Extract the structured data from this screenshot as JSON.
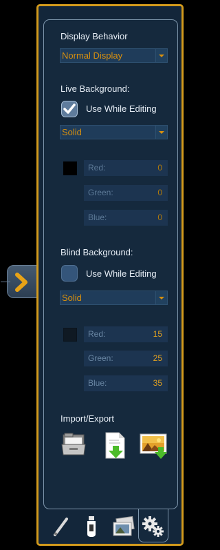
{
  "display_behavior": {
    "label": "Display Behavior",
    "value": "Normal Display"
  },
  "live_background": {
    "label": "Live Background:",
    "use_while_editing_label": "Use While Editing",
    "use_while_editing_checked": true,
    "mode": "Solid",
    "color": "#000000",
    "red_label": "Red:",
    "red": "0",
    "green_label": "Green:",
    "green": "0",
    "blue_label": "Blue:",
    "blue": "0"
  },
  "blind_background": {
    "label": "Blind Background:",
    "use_while_editing_label": "Use While Editing",
    "use_while_editing_checked": false,
    "mode": "Solid",
    "color": "#0f1923",
    "red_label": "Red:",
    "red": "15",
    "green_label": "Green:",
    "green": "25",
    "blue_label": "Blue:",
    "blue": "35"
  },
  "import_export": {
    "label": "Import/Export",
    "icons": [
      "folder-open-icon",
      "document-import-icon",
      "image-import-icon"
    ]
  },
  "tabs": [
    {
      "icon": "pencil-icon",
      "active": false
    },
    {
      "icon": "bottle-icon",
      "active": false
    },
    {
      "icon": "images-icon",
      "active": false
    },
    {
      "icon": "gears-icon",
      "active": true
    }
  ],
  "colors": {
    "accent": "#d39a1c",
    "value_text": "#d8900e",
    "panel_bg": "#15293d"
  }
}
